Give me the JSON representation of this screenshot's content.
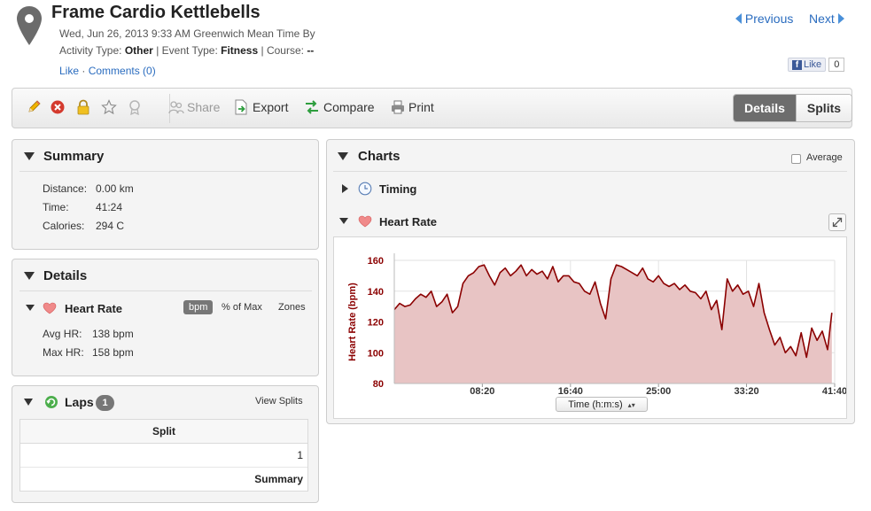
{
  "header": {
    "title": "Frame Cardio Kettlebells",
    "datetime": "Wed, Jun 26, 2013 9:33 AM Greenwich Mean Time By",
    "activity_type_label": "Activity Type:",
    "activity_type": "Other",
    "event_type_label": "| Event Type:",
    "event_type": "Fitness",
    "course_label": "| Course:",
    "course": "--",
    "like": "Like",
    "dot": "·",
    "comments": "Comments (0)",
    "prev": "Previous",
    "next": "Next",
    "fb_like": "Like",
    "fb_count": "0"
  },
  "toolbar": {
    "share": "Share",
    "export": "Export",
    "compare": "Compare",
    "print": "Print",
    "details": "Details",
    "splits": "Splits"
  },
  "summary": {
    "title": "Summary",
    "rows": [
      {
        "label": "Distance:",
        "value": "0.00 km"
      },
      {
        "label": "Time:",
        "value": "41:24"
      },
      {
        "label": "Calories:",
        "value": "294 C"
      }
    ]
  },
  "details": {
    "title": "Details",
    "heart_rate_title": "Heart Rate",
    "unit_bpm": "bpm",
    "unit_pct_max": "% of Max",
    "unit_zones": "Zones",
    "rows": [
      {
        "label": "Avg HR:",
        "value": "138 bpm"
      },
      {
        "label": "Max HR:",
        "value": "158 bpm"
      }
    ]
  },
  "laps": {
    "title": "Laps",
    "count": "1",
    "view_splits": "View Splits",
    "column": "Split",
    "rows": [
      "1",
      "Summary"
    ]
  },
  "charts": {
    "title": "Charts",
    "average_label": "Average",
    "timing_label": "Timing",
    "heart_rate_label": "Heart Rate",
    "axis_select": "Time (h:m:s)",
    "line_color": "#8b0000",
    "fill_color": "#e8c4c4"
  },
  "chart_data": {
    "type": "area",
    "title": "",
    "xlabel": "",
    "ylabel": "Heart Rate (bpm)",
    "ylim": [
      80,
      160
    ],
    "yticks": [
      "80",
      "100",
      "120",
      "140",
      "160"
    ],
    "xlim": [
      0,
      41.67
    ],
    "xticks": [
      {
        "x": 8.33,
        "label": "08:20"
      },
      {
        "x": 16.67,
        "label": "16:40"
      },
      {
        "x": 25.0,
        "label": "25:00"
      },
      {
        "x": 33.33,
        "label": "33:20"
      },
      {
        "x": 41.67,
        "label": "41:40"
      }
    ],
    "grid": true,
    "x_units": "minutes",
    "x": [
      0,
      0.5,
      1,
      1.5,
      2,
      2.5,
      3,
      3.5,
      4,
      4.5,
      5,
      5.5,
      6,
      6.5,
      7,
      7.5,
      8,
      8.5,
      9,
      9.5,
      10,
      10.5,
      11,
      11.5,
      12,
      12.5,
      13,
      13.5,
      14,
      14.5,
      15,
      15.5,
      16,
      16.5,
      17,
      17.5,
      18,
      18.5,
      19,
      19.5,
      20,
      20.5,
      21,
      21.5,
      22,
      22.5,
      23,
      23.5,
      24,
      24.5,
      25,
      25.5,
      26,
      26.5,
      27,
      27.5,
      28,
      28.5,
      29,
      29.5,
      30,
      30.5,
      31,
      31.5,
      32,
      32.5,
      33,
      33.5,
      34,
      34.5,
      35,
      35.5,
      36,
      36.5,
      37,
      37.5,
      38,
      38.5,
      39,
      39.5,
      40,
      40.5,
      41,
      41.4
    ],
    "y": [
      128,
      132,
      130,
      131,
      135,
      138,
      136,
      140,
      130,
      133,
      138,
      126,
      130,
      145,
      150,
      152,
      156,
      157,
      150,
      144,
      152,
      155,
      150,
      153,
      157,
      150,
      154,
      151,
      153,
      148,
      156,
      146,
      150,
      150,
      146,
      145,
      140,
      138,
      146,
      132,
      122,
      148,
      157,
      156,
      154,
      152,
      150,
      155,
      148,
      146,
      150,
      145,
      143,
      145,
      141,
      144,
      140,
      139,
      135,
      140,
      128,
      134,
      115,
      148,
      140,
      144,
      138,
      140,
      130,
      145,
      126,
      115,
      105,
      110,
      100,
      104,
      98,
      113,
      97,
      116,
      108,
      114,
      102,
      126
    ]
  }
}
